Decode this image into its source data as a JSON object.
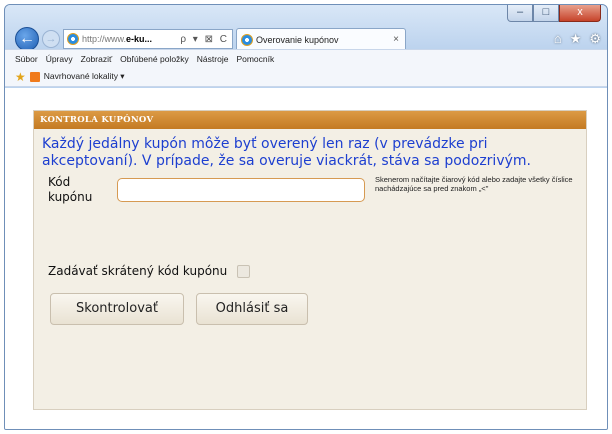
{
  "browser": {
    "window_controls": {
      "minimize": "–",
      "maximize": "□",
      "close": "x"
    },
    "address": {
      "prefix": "http://www.",
      "domain": "e-ku...",
      "tools": "ρ ▾ ⊠ C"
    },
    "tab": {
      "title": "Overovanie kupónov",
      "close": "×"
    },
    "toolbar_icons": {
      "home": "⌂",
      "favorites": "★",
      "settings": "⚙"
    },
    "menu": [
      "Súbor",
      "Úpravy",
      "Zobraziť",
      "Obľúbené položky",
      "Nástroje",
      "Pomocník"
    ],
    "favorites_bar": {
      "item": "Navrhované lokality ▾"
    }
  },
  "panel": {
    "header": "KONTROLA KUPÓNOV",
    "intro": "Každý jedálny kupón môže byť overený len raz (v prevádzke pri akceptovaní). V prípade, že sa overuje viackrát, stáva sa podozrivým.",
    "code_label": "Kód kupónu",
    "code_value": "",
    "hint": "Skenerom načítajte čiarový kód alebo zadajte všetky číslice nachádzajúce sa pred znakom „<\"",
    "short_code_label": "Zadávať skrátený kód kupónu",
    "check_button": "Skontrolovať",
    "logout_button": "Odhlásiť sa"
  },
  "colors": {
    "header_orange": "#c47a22",
    "intro_blue": "#1d3fd0",
    "panel_bg": "#f3efe5"
  }
}
